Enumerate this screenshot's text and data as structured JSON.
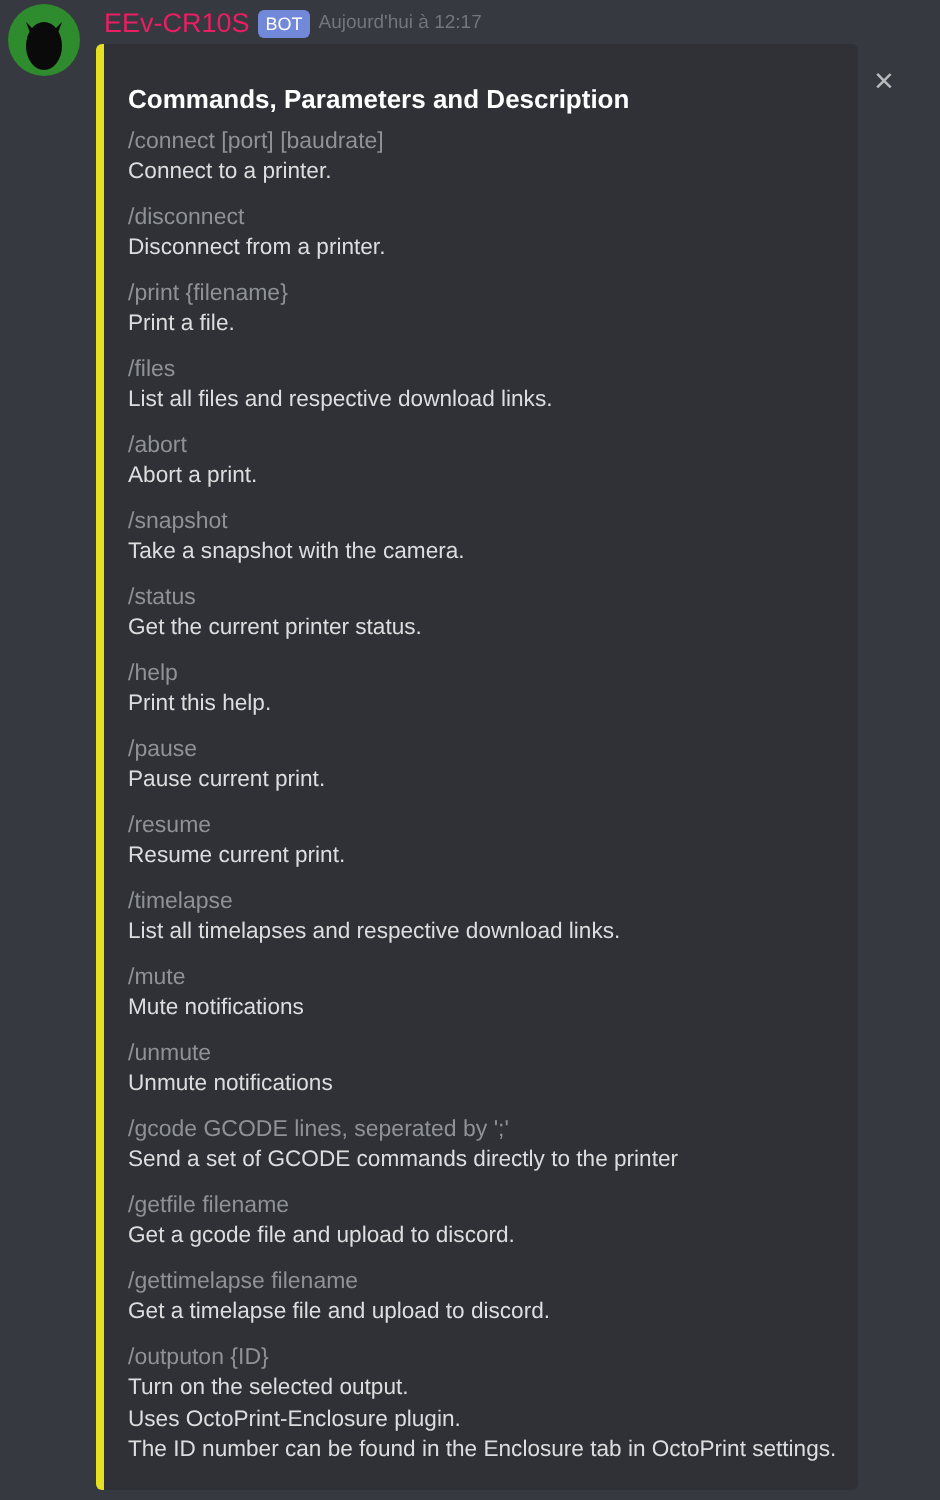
{
  "message": {
    "author": "EEv-CR10S",
    "badge": "BOT",
    "timestamp": "Aujourd'hui à 12:17",
    "close": "×"
  },
  "embed": {
    "title": "Commands, Parameters and Description",
    "fields": [
      {
        "name": "/connect [port] [baudrate]",
        "value": [
          "Connect to a printer."
        ]
      },
      {
        "name": "/disconnect",
        "value": [
          "Disconnect from a printer."
        ]
      },
      {
        "name": "/print {filename}",
        "value": [
          "Print a file."
        ]
      },
      {
        "name": "/files",
        "value": [
          "List all files and respective download links."
        ]
      },
      {
        "name": "/abort",
        "value": [
          "Abort a print."
        ]
      },
      {
        "name": "/snapshot",
        "value": [
          "Take a snapshot with the camera."
        ]
      },
      {
        "name": "/status",
        "value": [
          "Get the current printer status."
        ]
      },
      {
        "name": "/help",
        "value": [
          "Print this help."
        ]
      },
      {
        "name": "/pause",
        "value": [
          "Pause current print."
        ]
      },
      {
        "name": "/resume",
        "value": [
          "Resume current print."
        ]
      },
      {
        "name": "/timelapse",
        "value": [
          "List all timelapses and respective download links."
        ]
      },
      {
        "name": "/mute",
        "value": [
          "Mute notifications"
        ]
      },
      {
        "name": "/unmute",
        "value": [
          "Unmute notifications"
        ]
      },
      {
        "name": "/gcode GCODE lines, seperated by ';'",
        "value": [
          "Send a set of GCODE commands directly to the printer"
        ]
      },
      {
        "name": "/getfile filename",
        "value": [
          "Get a gcode file and upload to discord."
        ]
      },
      {
        "name": "/gettimelapse filename",
        "value": [
          "Get a timelapse file and upload to discord."
        ]
      },
      {
        "name": "/outputon {ID}",
        "value": [
          "Turn on the selected output.",
          "Uses OctoPrint-Enclosure plugin.",
          "The ID number can be found in the Enclosure tab in OctoPrint settings."
        ]
      }
    ]
  }
}
